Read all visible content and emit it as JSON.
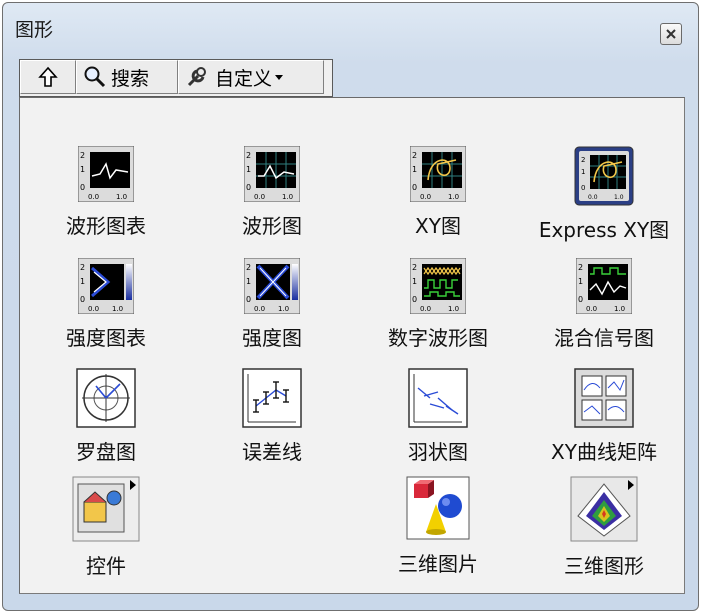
{
  "window": {
    "title": "图形"
  },
  "toolbar": {
    "search_label": "搜索",
    "custom_label": "自定义"
  },
  "palette": {
    "items": [
      {
        "label": "波形图表"
      },
      {
        "label": "波形图"
      },
      {
        "label": "XY图"
      },
      {
        "label": "Express XY图"
      },
      {
        "label": "强度图表"
      },
      {
        "label": "强度图"
      },
      {
        "label": "数字波形图"
      },
      {
        "label": "混合信号图"
      },
      {
        "label": "罗盘图"
      },
      {
        "label": "误差线"
      },
      {
        "label": "羽状图"
      },
      {
        "label": "XY曲线矩阵"
      },
      {
        "label": "控件"
      },
      {
        "label": "三维图片"
      },
      {
        "label": "三维图形"
      }
    ]
  },
  "icon_tick_labels": {
    "y_top": "2",
    "y_mid": "1",
    "y_bot": "0",
    "x_left": "0.0",
    "x_right": "1.0"
  },
  "colors": {
    "graph_bg": "#000000",
    "grid": "#2f7f7f",
    "intensity_blue": "#2a4bd6"
  }
}
